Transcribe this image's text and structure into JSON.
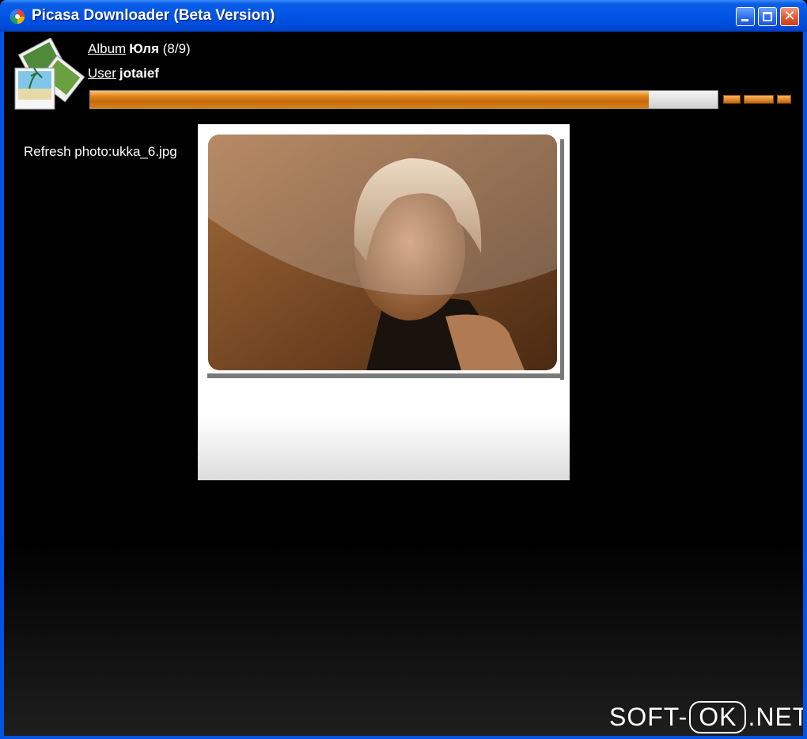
{
  "window": {
    "title": "Picasa Downloader (Beta Version)",
    "accent_color": "#0054e3",
    "close_color": "#e15a2e"
  },
  "header": {
    "album_link": "Album",
    "album_name": "Юля",
    "album_count": "(8/9)",
    "user_link": "User",
    "user_name": "jotaief"
  },
  "progress": {
    "fraction": 0.89,
    "fill_color": "#d8801e"
  },
  "status": {
    "text": "Refresh photo:ukka_6.jpg"
  },
  "icons": [
    "picasa-app-icon",
    "photo-stack-logo-icon",
    "minimize-icon",
    "maximize-icon",
    "close-icon"
  ],
  "watermark": {
    "left": "SOFT-",
    "boxed": "OK",
    "right": ".NET"
  }
}
